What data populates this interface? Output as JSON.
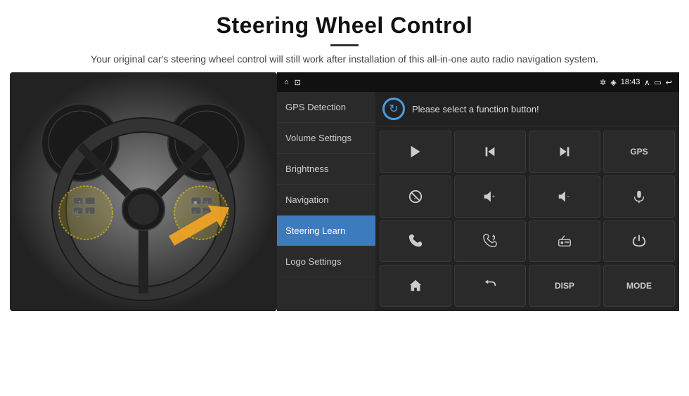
{
  "header": {
    "title": "Steering Wheel Control",
    "subtitle": "Your original car's steering wheel control will still work after installation of this all-in-one auto radio navigation system."
  },
  "statusBar": {
    "time": "18:43",
    "leftIcons": [
      "home-icon",
      "notification-icon"
    ],
    "rightIcons": [
      "bluetooth-icon",
      "wifi-icon",
      "expand-icon",
      "window-icon",
      "back-icon"
    ]
  },
  "menu": {
    "items": [
      {
        "label": "GPS Detection",
        "active": false
      },
      {
        "label": "Volume Settings",
        "active": false
      },
      {
        "label": "Brightness",
        "active": false
      },
      {
        "label": "Navigation",
        "active": false
      },
      {
        "label": "Steering Learn",
        "active": true
      },
      {
        "label": "Logo Settings",
        "active": false
      }
    ]
  },
  "topBar": {
    "message": "Please select a function button!"
  },
  "icons": [
    {
      "id": "play",
      "type": "play"
    },
    {
      "id": "prev",
      "type": "prev"
    },
    {
      "id": "next",
      "type": "next"
    },
    {
      "id": "gps",
      "type": "text",
      "label": "GPS"
    },
    {
      "id": "mute",
      "type": "mute"
    },
    {
      "id": "vol-up",
      "type": "vol-up"
    },
    {
      "id": "vol-down",
      "type": "vol-down"
    },
    {
      "id": "mic",
      "type": "mic"
    },
    {
      "id": "phone",
      "type": "phone"
    },
    {
      "id": "call",
      "type": "call"
    },
    {
      "id": "radio",
      "type": "radio"
    },
    {
      "id": "power",
      "type": "power"
    },
    {
      "id": "home",
      "type": "home"
    },
    {
      "id": "back",
      "type": "back"
    },
    {
      "id": "disp",
      "type": "text",
      "label": "DISP"
    },
    {
      "id": "mode",
      "type": "text",
      "label": "MODE"
    }
  ]
}
